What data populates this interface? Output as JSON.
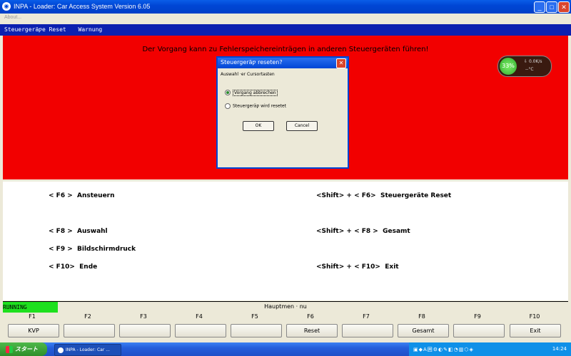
{
  "window": {
    "title": "INPA - Loader:  Car Access System Version 6.05",
    "min_label": "_",
    "max_label": "□",
    "close_label": "✕"
  },
  "menu": {
    "about": "About..."
  },
  "statusline": {
    "left": "Steuergeräƿe Reset",
    "right": "Warnung"
  },
  "warning": "Der Vorgang kann zu Fehlerspeichereinträgen in anderen Steuergeräten führen!",
  "gauge": {
    "percent": "33%",
    "speed": "0.0K/s",
    "temp": "--°C",
    "color_ok": "#2ea82a"
  },
  "dialog": {
    "title": "Steuergeräƿ reseten?",
    "close": "✕",
    "prompt": "Auswahl ·er Cursortasten",
    "options": [
      {
        "label": "Vorgang abbrechen",
        "selected": true
      },
      {
        "label": "Steuergeräƿ wird resetet",
        "selected": false
      }
    ],
    "ok": "OK",
    "cancel": "Cancel"
  },
  "keys_left": [
    "< F6 >  Ansteuern",
    "< F8 >  Auswahl",
    "< F9 >  Bildschirmdruck",
    "< F10>  Ende"
  ],
  "keys_right": [
    "<Shift> + < F6>  Steuergeräte Reset",
    "<Shift> + < F8 >  Gesamt",
    "<Shift> + < F10>  Exit"
  ],
  "status": {
    "running": "RUNNING",
    "menu": "Hauptmen · nu"
  },
  "fkeys": [
    {
      "key": "F1",
      "label": "KVP"
    },
    {
      "key": "F2",
      "label": ""
    },
    {
      "key": "F3",
      "label": ""
    },
    {
      "key": "F4",
      "label": ""
    },
    {
      "key": "F5",
      "label": ""
    },
    {
      "key": "F6",
      "label": "Reset"
    },
    {
      "key": "F7",
      "label": ""
    },
    {
      "key": "F8",
      "label": "Gesamt"
    },
    {
      "key": "F9",
      "label": ""
    },
    {
      "key": "F10",
      "label": "Exit"
    }
  ],
  "taskbar": {
    "start": "スタート",
    "item": "INPA - Loader:  Car ...",
    "tray_icons": "▣◆A囲⚙◐✎◧◔▥⬡◈",
    "clock": "14:24"
  },
  "colors": {
    "red_area": "#f20000",
    "running": "#1ee01e",
    "statusline": "#0b20b0"
  }
}
